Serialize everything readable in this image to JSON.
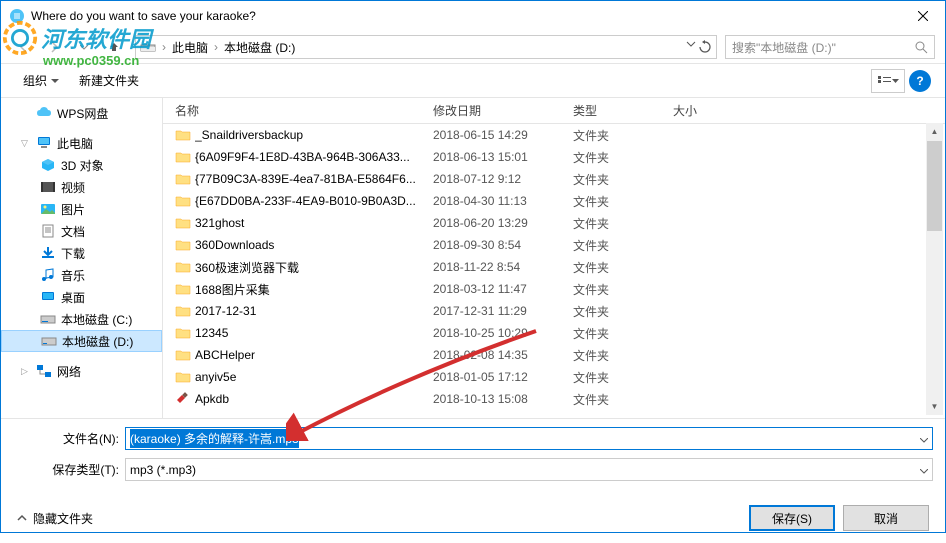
{
  "title": "Where do you want to save your karaoke?",
  "watermark": {
    "brand": "河东软件园",
    "url": "www.pc0359.cn"
  },
  "breadcrumb": {
    "sep": "›",
    "item1": "此电脑",
    "item2": "本地磁盘 (D:)"
  },
  "search": {
    "placeholder": "搜索\"本地磁盘 (D:)\""
  },
  "toolbar": {
    "organize": "组织",
    "newfolder": "新建文件夹"
  },
  "columns": {
    "name": "名称",
    "date": "修改日期",
    "type": "类型",
    "size": "大小"
  },
  "sidebar": {
    "wps": "WPS网盘",
    "thispc": "此电脑",
    "items": [
      {
        "label": "3D 对象"
      },
      {
        "label": "视频"
      },
      {
        "label": "图片"
      },
      {
        "label": "文档"
      },
      {
        "label": "下载"
      },
      {
        "label": "音乐"
      },
      {
        "label": "桌面"
      },
      {
        "label": "本地磁盘 (C:)"
      },
      {
        "label": "本地磁盘 (D:)"
      }
    ],
    "network": "网络"
  },
  "files": [
    {
      "name": "_Snaildriversbackup",
      "date": "2018-06-15 14:29",
      "type": "文件夹",
      "icon": "folder"
    },
    {
      "name": "{6A09F9F4-1E8D-43BA-964B-306A33...",
      "date": "2018-06-13 15:01",
      "type": "文件夹",
      "icon": "folder"
    },
    {
      "name": "{77B09C3A-839E-4ea7-81BA-E5864F6...",
      "date": "2018-07-12 9:12",
      "type": "文件夹",
      "icon": "folder"
    },
    {
      "name": "{E67DD0BA-233F-4EA9-B010-9B0A3D...",
      "date": "2018-04-30 11:13",
      "type": "文件夹",
      "icon": "folder"
    },
    {
      "name": "321ghost",
      "date": "2018-06-20 13:29",
      "type": "文件夹",
      "icon": "folder"
    },
    {
      "name": "360Downloads",
      "date": "2018-09-30 8:54",
      "type": "文件夹",
      "icon": "folder"
    },
    {
      "name": "360极速浏览器下载",
      "date": "2018-11-22 8:54",
      "type": "文件夹",
      "icon": "folder"
    },
    {
      "name": "1688图片采集",
      "date": "2018-03-12 11:47",
      "type": "文件夹",
      "icon": "folder"
    },
    {
      "name": "2017-12-31",
      "date": "2017-12-31 11:29",
      "type": "文件夹",
      "icon": "folder"
    },
    {
      "name": "12345",
      "date": "2018-10-25 10:29",
      "type": "文件夹",
      "icon": "folder"
    },
    {
      "name": "ABCHelper",
      "date": "2018-02-08 14:35",
      "type": "文件夹",
      "icon": "folder"
    },
    {
      "name": "anyiv5e",
      "date": "2018-01-05 17:12",
      "type": "文件夹",
      "icon": "folder"
    },
    {
      "name": "Apkdb",
      "date": "2018-10-13 15:08",
      "type": "文件夹",
      "icon": "hammer"
    }
  ],
  "fields": {
    "filename_label": "文件名(N):",
    "filename_value": "(karaoke) 多余的解释-许嵩.mp3",
    "filetype_label": "保存类型(T):",
    "filetype_value": "mp3 (*.mp3)"
  },
  "footer": {
    "hide": "隐藏文件夹",
    "save": "保存(S)",
    "cancel": "取消"
  }
}
